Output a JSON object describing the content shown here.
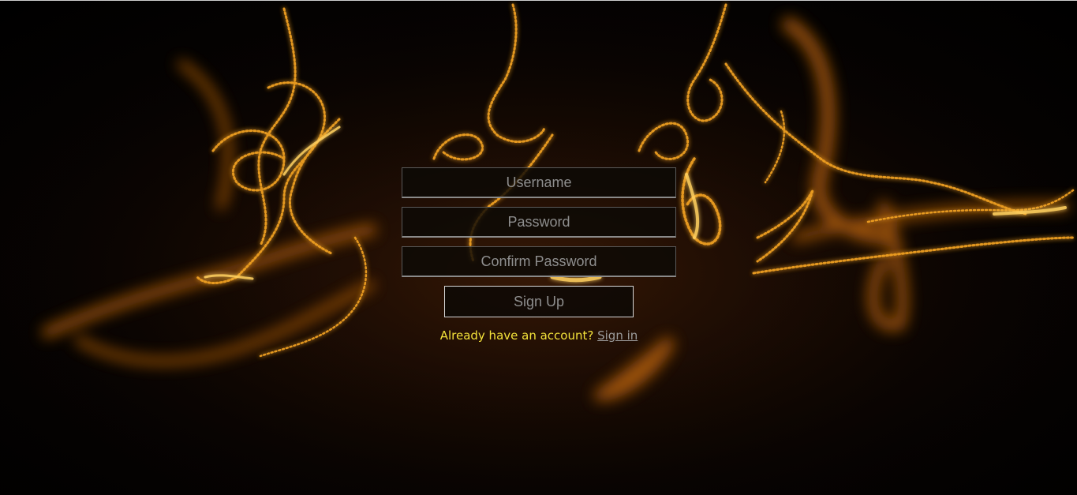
{
  "signup_form": {
    "username_placeholder": "Username",
    "password_placeholder": "Password",
    "confirm_password_placeholder": "Confirm Password",
    "submit_label": "Sign Up"
  },
  "signin": {
    "prompt": "Already have an account?",
    "link_label": "Sign in"
  },
  "colors": {
    "prompt_text": "#f3e23a",
    "link_text": "#9c9c9c",
    "light_trails": "#f0a020"
  }
}
